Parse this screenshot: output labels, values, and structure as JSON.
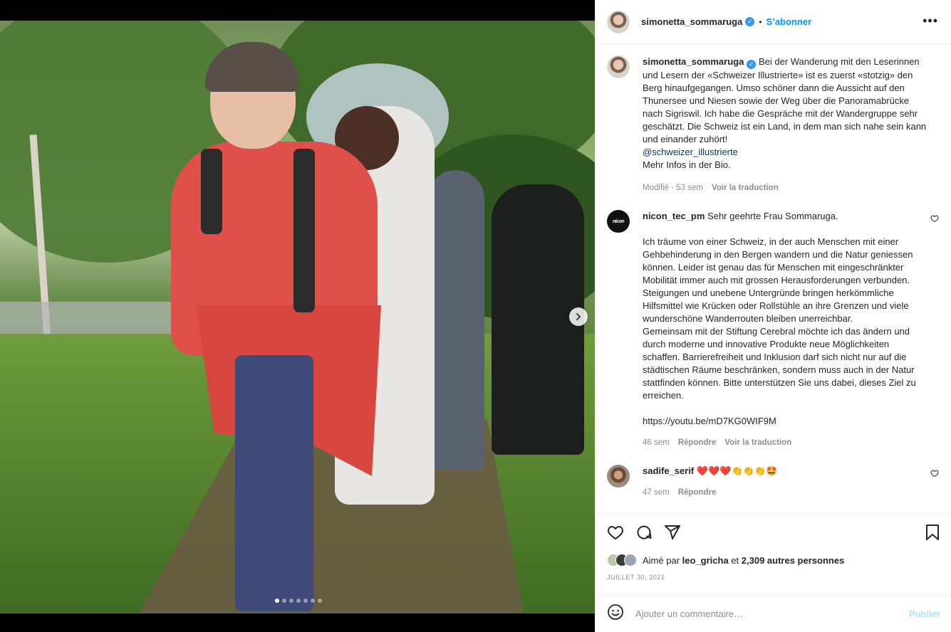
{
  "header": {
    "username": "simonetta_sommaruga",
    "separator": "•",
    "follow_label": "S’abonner",
    "more_label": "•••"
  },
  "caption": {
    "username": "simonetta_sommaruga",
    "text": "Bei der Wanderung mit den Leserinnen und Lesern der «Schweizer Illustrierte» ist es zuerst «stotzig» den Berg hinaufgegangen. Umso schöner dann die Aussicht auf den Thunersee und Niesen sowie der Weg über die Panoramabrücke nach Sigriswil. Ich habe die Gespräche mit der Wandergruppe sehr geschätzt. Die Schweiz ist ein Land, in dem man sich nahe sein kann und einander zuhört!",
    "mention": "@schweizer_illustrierte",
    "text_end": "Mehr Infos in der Bio.",
    "meta_time": "Modifié · 53 sem",
    "meta_translate": "Voir la traduction"
  },
  "comments": [
    {
      "username": "nicon_tec_pm",
      "avatar_text": "nicon",
      "text": "Sehr geehrte Frau Sommaruga.\n\nIch träume von einer Schweiz, in der auch Menschen mit einer Gehbehinderung in den Bergen wandern und die Natur geniessen können. Leider ist genau das für Menschen mit eingeschränkter Mobilität immer auch mit grossen Herausforderungen verbunden. Steigungen und unebene Untergründe bringen herkömmliche Hilfsmittel wie Krücken oder Rollstühle an ihre Grenzen und viele wunderschöne Wanderrouten bleiben unerreichbar.\nGemeinsam mit der Stiftung Cerebral möchte ich das ändern und durch moderne und innovative Produkte neue Möglichkeiten schaffen. Barrierefreiheit und Inklusion darf sich nicht nur auf die städtischen Räume beschränken, sondern muss auch in der Natur stattfinden können. Bitte unterstützen Sie uns dabei, dieses Ziel zu erreichen.\n\nhttps://youtu.be/mD7KG0WIF9M",
      "time": "46 sem",
      "reply": "Répondre",
      "translate": "Voir la traduction"
    },
    {
      "username": "sadife_serif",
      "text": "❤️❤️❤️👏👏👏🤩",
      "time": "47 sem",
      "reply": "Répondre"
    }
  ],
  "likes": {
    "prefix": "Aimé par",
    "user": "leo_gricha",
    "mid": "et",
    "count_text": "2,309 autres personnes"
  },
  "date": "JUILLET 30, 2021",
  "add_comment": {
    "placeholder": "Ajouter un commentaire…",
    "publish_label": "Publier"
  },
  "icons": {
    "heart": "heart-icon",
    "comment": "comment-icon",
    "share": "share-icon",
    "save": "bookmark-icon",
    "emoji": "emoji-icon",
    "next": "chevron-right-icon"
  },
  "colors": {
    "accent": "#0095f6",
    "verified": "#3897f0",
    "muted": "#8e8e8e"
  },
  "carousel": {
    "total_slides": 7,
    "active_index": 0
  }
}
